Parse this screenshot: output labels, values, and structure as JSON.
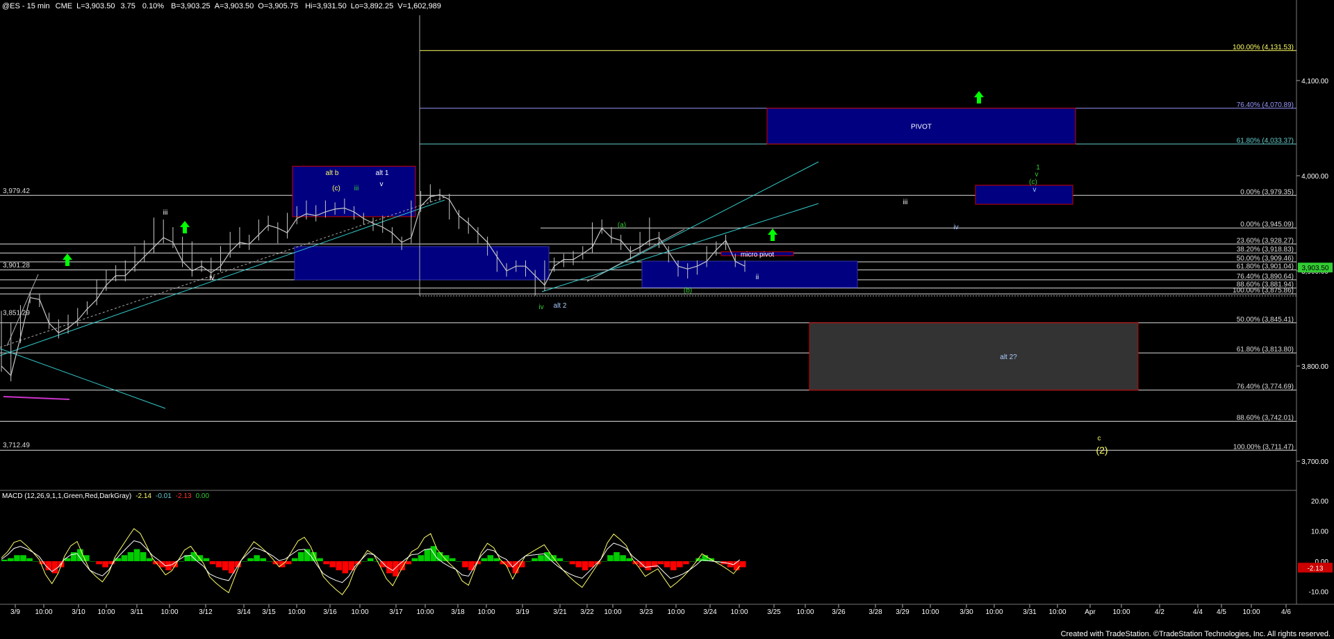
{
  "header": {
    "symbol": "@ES - 15 min",
    "exchange": "CME",
    "last": "L=3,903.50",
    "change": "3.75",
    "change_pct": "0.10%",
    "bid": "B=3,903.25",
    "ask": "A=3,903.50",
    "open": "O=3,905.75",
    "high": "Hi=3,931.50",
    "low": "Lo=3,892.25",
    "volume": "V=1,602,989"
  },
  "footer": {
    "credit": "Created with TradeStation. ©TradeStation Technologies, Inc. All rights reserved."
  },
  "colors": {
    "background": "#000000",
    "price": "#c8c8c8",
    "fib_yellow": "#ffff66",
    "fib_teal": "#66cccc",
    "fib_blue": "#9999ff",
    "box_fill": "#000080",
    "box_border": "#cc0000",
    "channel": "#33cccc",
    "wave_green": "#33cc33",
    "wave_yellow": "#ffff66",
    "arrow_green": "#00ff00",
    "macd_up": "#00cc00",
    "macd_down": "#ff0000"
  },
  "chart_data": [
    {
      "type": "candlestick",
      "title": "@ES - 15 min",
      "ylim": [
        3655,
        4175
      ],
      "y_ticks": [
        "4,100.00",
        "4,000.00",
        "3,900.00",
        "3,800.00",
        "3,700.00"
      ],
      "x_ticks": [
        "3/9",
        "10:00",
        "3/10",
        "10:00",
        "3/11",
        "10:00",
        "3/12",
        "3/14",
        "3/15",
        "10:00",
        "3/16",
        "10:00",
        "3/17",
        "10:00",
        "3/18",
        "10:00",
        "3/19",
        "3/21",
        "3/22",
        "10:00",
        "3/23",
        "10:00",
        "3/24",
        "10:00",
        "3/25",
        "10:00",
        "3/26",
        "3/28",
        "3/29",
        "10:00",
        "3/30",
        "10:00",
        "3/31",
        "10:00",
        "Apr",
        "10:00",
        "4/2",
        "4/4",
        "4/5",
        "10:00",
        "4/6"
      ],
      "last_price_label": "3,903.50",
      "left_price_labels": [
        "3,979.42",
        "3,901.28",
        "3,851.29",
        "3,712.49"
      ],
      "price_path": [
        [
          3852,
          3800
        ],
        [
          3840,
          3790
        ],
        [
          3858,
          3830
        ],
        [
          3872,
          3872
        ],
        [
          3868,
          3870
        ],
        [
          3850,
          3845
        ],
        [
          3843,
          3835
        ],
        [
          3848,
          3840
        ],
        [
          3855,
          3848
        ],
        [
          3862,
          3860
        ],
        [
          3885,
          3870
        ],
        [
          3895,
          3885
        ],
        [
          3900,
          3895
        ],
        [
          3905,
          3895
        ],
        [
          3920,
          3905
        ],
        [
          3926,
          3915
        ],
        [
          3950,
          3925
        ],
        [
          3948,
          3935
        ],
        [
          3940,
          3930
        ],
        [
          3930,
          3910
        ],
        [
          3925,
          3900
        ],
        [
          3905,
          3905
        ],
        [
          3908,
          3898
        ],
        [
          3920,
          3905
        ],
        [
          3935,
          3920
        ],
        [
          3940,
          3930
        ],
        [
          3932,
          3928
        ],
        [
          3948,
          3938
        ],
        [
          3952,
          3948
        ],
        [
          3935,
          3945
        ],
        [
          3955,
          3940
        ],
        [
          3962,
          3955
        ],
        [
          3968,
          3960
        ],
        [
          3963,
          3958
        ],
        [
          3968,
          3962
        ],
        [
          3966,
          3965
        ],
        [
          3970,
          3966
        ],
        [
          3960,
          3962
        ],
        [
          3955,
          3955
        ],
        [
          3948,
          3950
        ],
        [
          3952,
          3946
        ],
        [
          3935,
          3940
        ],
        [
          3928,
          3930
        ],
        [
          3968,
          3935
        ],
        [
          3978,
          3968
        ],
        [
          3985,
          3978
        ],
        [
          3980,
          3980
        ],
        [
          3960,
          3975
        ],
        [
          3950,
          3958
        ],
        [
          3945,
          3950
        ],
        [
          3935,
          3940
        ],
        [
          3922,
          3930
        ],
        [
          3905,
          3915
        ],
        [
          3902,
          3900
        ],
        [
          3905,
          3905
        ],
        [
          3900,
          3905
        ],
        [
          3880,
          3895
        ],
        [
          3905,
          3885
        ],
        [
          3908,
          3905
        ],
        [
          3910,
          3912
        ],
        [
          3915,
          3912
        ],
        [
          3920,
          3918
        ],
        [
          3945,
          3925
        ],
        [
          3948,
          3945
        ],
        [
          3940,
          3935
        ],
        [
          3928,
          3932
        ],
        [
          3918,
          3920
        ],
        [
          3935,
          3925
        ],
        [
          3950,
          3932
        ],
        [
          3930,
          3935
        ],
        [
          3915,
          3920
        ],
        [
          3900,
          3905
        ],
        [
          3898,
          3902
        ],
        [
          3902,
          3905
        ],
        [
          3920,
          3910
        ],
        [
          3925,
          3922
        ],
        [
          3928,
          3932
        ],
        [
          3912,
          3910
        ],
        [
          3905,
          3905
        ]
      ],
      "candle_count": 80,
      "fib_levels": [
        {
          "label": "100.00% (4,131.53)",
          "value": 4131.53
        },
        {
          "label": "76.40% (4,070.89)",
          "value": 4070.89
        },
        {
          "label": "61.80% (4,033.37)",
          "value": 4033.37
        },
        {
          "label": "0.00% (3,979.35)",
          "value": 3979.35
        },
        {
          "label": "0.00% (3,945.09)",
          "value": 3945.09
        },
        {
          "label": "23.60% (3,928.27)",
          "value": 3928.27
        },
        {
          "label": "38.20% (3,918.83)",
          "value": 3918.83
        },
        {
          "label": "50.00% (3,909.46)",
          "value": 3909.46
        },
        {
          "label": "61.80% (3,901.04)",
          "value": 3901.04
        },
        {
          "label": "76.40% (3,890.64)",
          "value": 3890.64
        },
        {
          "label": "88.60% (3,881.94)",
          "value": 3881.94
        },
        {
          "label": "100.00% (3,875.86)",
          "value": 3875.86
        },
        {
          "label": "50.00% (3,845.41)",
          "value": 3845.41
        },
        {
          "label": "61.80% (3,813.80)",
          "value": 3813.8
        },
        {
          "label": "76.40% (3,774.69)",
          "value": 3774.69
        },
        {
          "label": "88.60% (3,742.01)",
          "value": 3742.01
        },
        {
          "label": "100.00% (3,711.47)",
          "value": 3711.47
        }
      ],
      "zones": [
        {
          "label": "PIVOT",
          "top": 4070.89,
          "bottom": 4033.37
        },
        {
          "label": "alt 2?",
          "top": 3845.41,
          "bottom": 3774.69
        },
        {
          "label": "micro pivot",
          "top": 3920,
          "bottom": 3916
        },
        {
          "label": "alt b",
          "top": 4010,
          "bottom": 3957
        },
        {
          "label": "",
          "top": 3990,
          "bottom": 3970
        }
      ],
      "wave_labels": [
        "iii",
        "iv",
        "alt b",
        "(c)",
        "iii",
        "alt 1",
        "v",
        "(a)",
        "iv",
        "alt 2",
        "(b)",
        "ii",
        "iii",
        "iv",
        "(c)",
        "v",
        "v",
        "1",
        "c",
        "(2)"
      ]
    },
    {
      "type": "bar",
      "title": "MACD (12,26,9,1,1,Green,Red,DarkGray)",
      "readouts": [
        "-2.14",
        "-0.01",
        "-2.13",
        "0.00"
      ],
      "y_ticks": [
        "20.00",
        "10.00",
        "0.00",
        "-10.00"
      ],
      "last_label": "-2.13",
      "ylim": [
        -14,
        24
      ],
      "histogram": [
        0.5,
        1,
        2,
        2,
        1,
        0,
        -1,
        -3,
        -4,
        -2,
        1,
        3,
        4,
        2,
        0,
        -1,
        -2,
        -1,
        1,
        2,
        3,
        4,
        3,
        1,
        -1,
        -2,
        -3,
        -2,
        0,
        2,
        3,
        2,
        1,
        -1,
        -2,
        -3,
        -4,
        -2,
        0,
        1,
        2,
        1,
        0,
        -1,
        -2,
        -1,
        1,
        3,
        4,
        3,
        1,
        -1,
        -2,
        -3,
        -4,
        -3,
        -1,
        0,
        1,
        0,
        -2,
        -4,
        -5,
        -3,
        -1,
        1,
        2,
        4,
        5,
        3,
        2,
        1,
        0,
        -2,
        -3,
        -1,
        1,
        2,
        1,
        -1,
        -2,
        -4,
        -2,
        0,
        1,
        2,
        3,
        2,
        1,
        0,
        -1,
        -2,
        -3,
        -2,
        -1,
        0,
        2,
        3,
        2,
        1,
        -1,
        -2,
        -3,
        -2,
        -1,
        -2,
        -3,
        -2,
        -1,
        0,
        1,
        2,
        1,
        0,
        -1,
        -2,
        -3,
        -2
      ]
    }
  ]
}
